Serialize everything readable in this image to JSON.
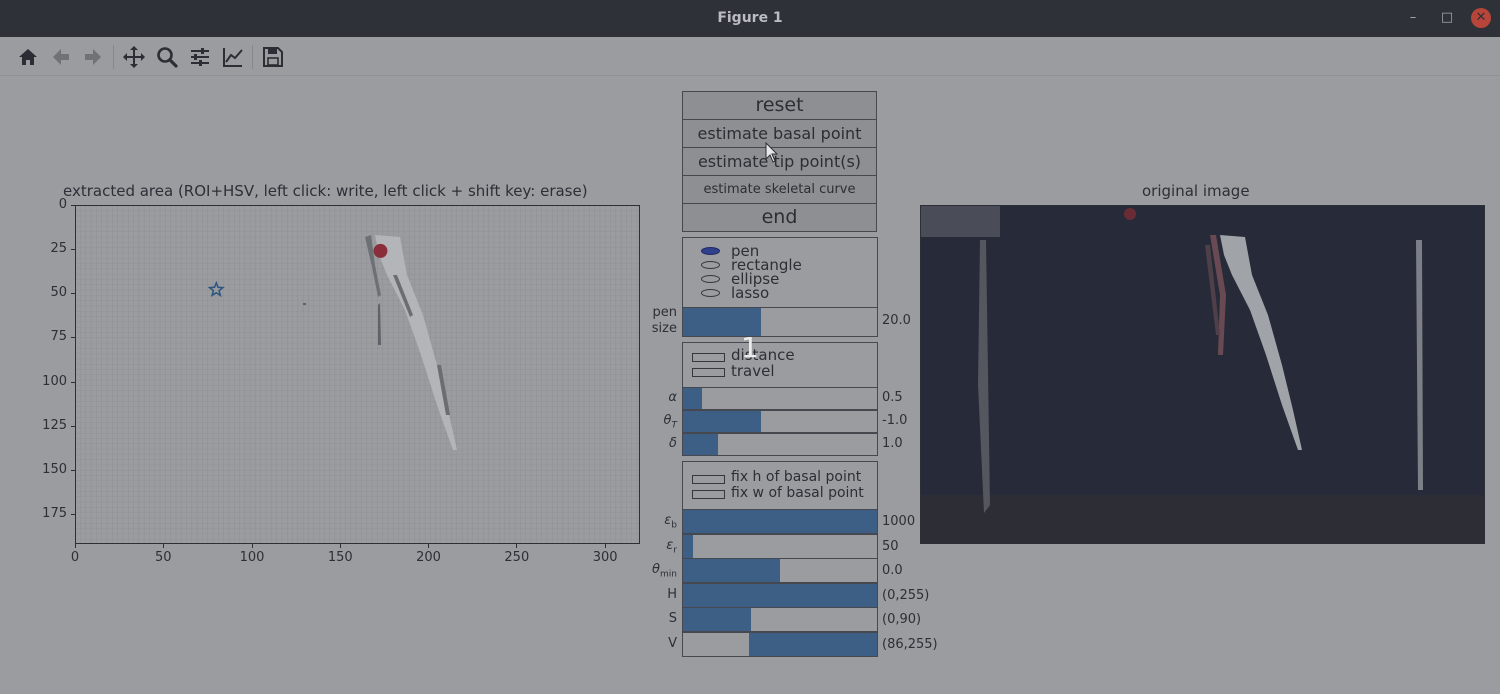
{
  "window": {
    "title": "Figure 1",
    "min_glyph": "–",
    "max_glyph": "□",
    "close_glyph": "✕"
  },
  "toolbar": {
    "icons": [
      "home-icon",
      "back-icon",
      "forward-icon",
      "pan-icon",
      "zoom-icon",
      "configure-subplots-icon",
      "edit-axis-icon",
      "save-icon"
    ]
  },
  "left_plot": {
    "title": "extracted area (ROI+HSV, left click: write, left click + shift key: erase)",
    "x_ticks": [
      "0",
      "50",
      "100",
      "150",
      "200",
      "250",
      "300"
    ],
    "y_ticks": [
      "0",
      "25",
      "50",
      "75",
      "100",
      "125",
      "150",
      "175"
    ],
    "xlim": [
      0,
      320
    ],
    "ylim": [
      192,
      0
    ],
    "grid": true,
    "markers": [
      {
        "name": "basal-point-marker",
        "shape": "star",
        "x": 80,
        "y": 48,
        "color": "#2c5680"
      },
      {
        "name": "tip-point-marker",
        "shape": "circle",
        "x": 173,
        "y": 26,
        "color": "#8a2e3a"
      }
    ]
  },
  "right_plot": {
    "title": "original image"
  },
  "buttons": {
    "reset": "reset",
    "estimate_basal": "estimate basal point",
    "estimate_tip": "estimate tip point(s)",
    "estimate_skeletal": "estimate skeletal curve",
    "end": "end"
  },
  "tool_radio": {
    "options": [
      "pen",
      "rectangle",
      "ellipse",
      "lasso"
    ],
    "selected": "pen"
  },
  "pen_size": {
    "label_line1": "pen",
    "label_line2": "size",
    "value": "20.0",
    "fraction": 0.4
  },
  "distance_checks": {
    "options": [
      "distance",
      "travel"
    ]
  },
  "params_a": [
    {
      "label": "α",
      "value": "0.5",
      "fraction": 0.1
    },
    {
      "label": "θ",
      "sub": "T",
      "value": "-1.0",
      "fraction": 0.4
    },
    {
      "label": "δ",
      "value": "1.0",
      "fraction": 0.18
    }
  ],
  "fix_checks": {
    "options": [
      "fix h of basal point",
      "fix w of basal point"
    ]
  },
  "params_b": [
    {
      "label": "ε",
      "sub": "b",
      "value": "1000",
      "fraction_start": 0.0,
      "fraction_end": 1.0
    },
    {
      "label": "ε",
      "sub": "r",
      "value": "50",
      "fraction_start": 0.0,
      "fraction_end": 0.05
    },
    {
      "label": "θ",
      "sub": "min",
      "value": "0.0",
      "fraction_start": 0.0,
      "fraction_end": 0.5
    },
    {
      "label": "H",
      "value": "(0,255)",
      "fraction_start": 0.0,
      "fraction_end": 1.0
    },
    {
      "label": "S",
      "value": "(0,90)",
      "fraction_start": 0.0,
      "fraction_end": 0.35
    },
    {
      "label": "V",
      "value": "(86,255)",
      "fraction_start": 0.34,
      "fraction_end": 1.0
    }
  ],
  "overlay_number": "1"
}
